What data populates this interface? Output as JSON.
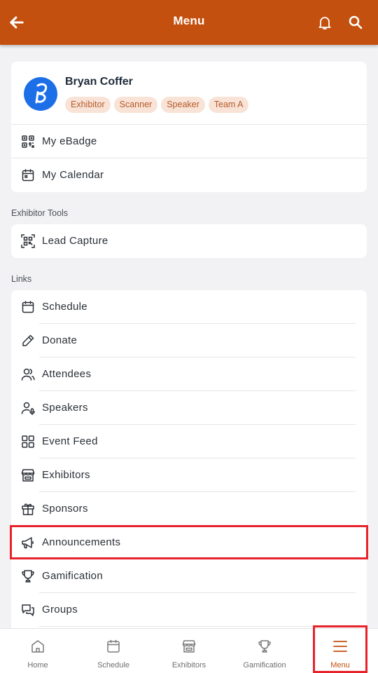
{
  "header": {
    "title": "Menu",
    "back_icon": "arrow-left-icon",
    "bell_icon": "bell-icon",
    "search_icon": "search-icon",
    "color": "#c4500f"
  },
  "profile": {
    "name": "Bryan Coffer",
    "avatar_icon": "user-avatar-logo",
    "tags": [
      "Exhibitor",
      "Scanner",
      "Speaker",
      "Team A"
    ]
  },
  "profile_items": [
    {
      "label": "My eBadge",
      "icon": "qr-code-icon"
    },
    {
      "label": "My Calendar",
      "icon": "calendar-icon"
    }
  ],
  "exhibitor_tools": {
    "title": "Exhibitor Tools",
    "items": [
      {
        "label": "Lead Capture",
        "icon": "scan-qr-icon"
      }
    ]
  },
  "links": {
    "title": "Links",
    "items": [
      {
        "label": "Schedule",
        "icon": "calendar-icon"
      },
      {
        "label": "Donate",
        "icon": "pencil-icon"
      },
      {
        "label": "Attendees",
        "icon": "users-icon"
      },
      {
        "label": "Speakers",
        "icon": "speaker-user-icon"
      },
      {
        "label": "Event Feed",
        "icon": "grid-icon"
      },
      {
        "label": "Exhibitors",
        "icon": "storefront-icon"
      },
      {
        "label": "Sponsors",
        "icon": "gift-icon"
      },
      {
        "label": "Announcements",
        "icon": "megaphone-icon"
      },
      {
        "label": "Gamification",
        "icon": "trophy-icon"
      },
      {
        "label": "Groups",
        "icon": "chat-bubbles-icon"
      }
    ]
  },
  "bottom_nav": {
    "active": "Menu",
    "items": [
      {
        "label": "Home",
        "icon": "home-icon"
      },
      {
        "label": "Schedule",
        "icon": "calendar-icon"
      },
      {
        "label": "Exhibitors",
        "icon": "storefront-icon"
      },
      {
        "label": "Gamification",
        "icon": "trophy-icon"
      },
      {
        "label": "Menu",
        "icon": "hamburger-menu-icon"
      }
    ]
  },
  "highlight_color": "#e8222a"
}
